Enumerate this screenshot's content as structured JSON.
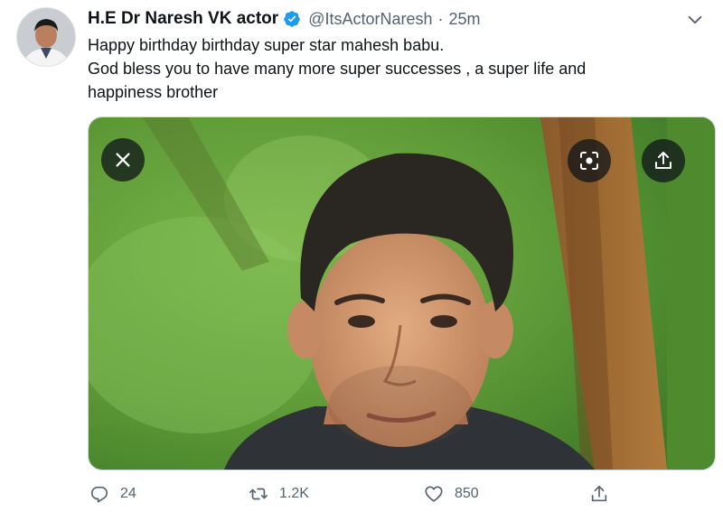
{
  "tweet": {
    "display_name": "H.E Dr Naresh VK actor",
    "handle": "@ItsActorNaresh",
    "separator": "·",
    "time": "25m",
    "text_lines": [
      "Happy birthday birthday super star mahesh babu.",
      "God bless you to have many more super successes , a super life and",
      "happiness brother"
    ]
  },
  "actions": {
    "reply_count": "24",
    "retweet_count": "1.2K",
    "like_count": "850"
  },
  "icons": {
    "verified": "verified-badge-icon",
    "more": "chevron-down-icon",
    "close": "close-icon",
    "lens": "lens-scan-icon",
    "share": "share-icon",
    "reply": "reply-icon",
    "retweet": "retweet-icon",
    "like": "heart-icon"
  },
  "colors": {
    "verified": "#1d9bf0",
    "secondary_text": "#536471",
    "primary_text": "#0f1419"
  }
}
